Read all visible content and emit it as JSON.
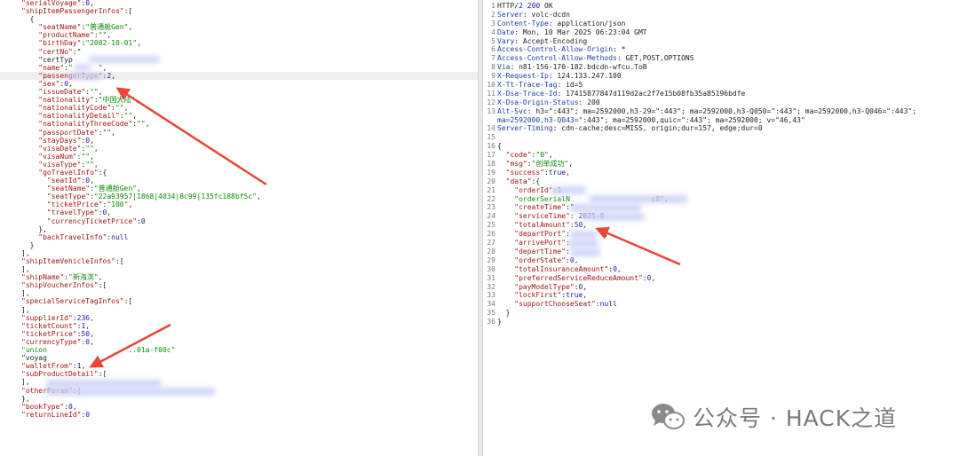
{
  "left_lines": [
    {
      "text": "\"serialVoyage\":0,"
    },
    {
      "text": "\"shipItemPassengerInfos\":["
    },
    {
      "text": "  {"
    },
    {
      "text": "    \"seatName\":\"普通舱Gen\","
    },
    {
      "text": "    \"productName\":\"\","
    },
    {
      "text": "    \"birthDay\":\"2002-10-01\","
    },
    {
      "text": "    \"certNo\":\""
    },
    {
      "text": "    \"certTyp"
    },
    {
      "text": "    \"name\":\"      \","
    },
    {
      "text": "    \"passengerType\":2,",
      "hl": true
    },
    {
      "text": "    \"sex\":0,"
    },
    {
      "text": "    \"issueDate\":\"\","
    },
    {
      "text": "    \"nationality\":\"中国大陆\","
    },
    {
      "text": "    \"nationalityCode\":\"\","
    },
    {
      "text": "    \"nationalityDetail\":\"\","
    },
    {
      "text": "    \"nationalityThreeCode\":\"\","
    },
    {
      "text": "    \"passportDate\":\"\","
    },
    {
      "text": "    \"stayDays\":0,"
    },
    {
      "text": "    \"visaDate\":\"\","
    },
    {
      "text": "    \"visaNum\":\"\","
    },
    {
      "text": "    \"visaType\":\"\","
    },
    {
      "text": "    \"goTravelInfo\":{"
    },
    {
      "text": "      \"seatId\":0,"
    },
    {
      "text": "      \"seatName\":\"普通舱Gen\","
    },
    {
      "text": "      \"seatType\":\"22a93957|1868|4034|8c99|135fc188bf5c\","
    },
    {
      "text": "      \"ticketPrice\":\"100\","
    },
    {
      "text": "      \"travelType\":0,"
    },
    {
      "text": "      \"currencyTicketPrice\":0"
    },
    {
      "text": "    },"
    },
    {
      "text": "    \"backTravelInfo\":null"
    },
    {
      "text": "  }"
    },
    {
      "text": "],"
    },
    {
      "text": "\"shipItemVehicleInfos\":["
    },
    {
      "text": "],"
    },
    {
      "text": "\"shipName\":\"新海滨\","
    },
    {
      "text": "\"shipVoucherInfos\":["
    },
    {
      "text": "],"
    },
    {
      "text": "\"specialServiceTagInfos\":["
    },
    {
      "text": "],"
    },
    {
      "text": "\"supplierId\":236,"
    },
    {
      "text": "\"ticketCount\":1,"
    },
    {
      "text": "\"ticketPrice\":50,"
    },
    {
      "text": "\"currencyType\":0,"
    },
    {
      "text": "\"union                   ..01a-f00c\""
    },
    {
      "text": "\"voyag"
    },
    {
      "text": "\"walletFrom\":1,"
    },
    {
      "text": "\"subProductDetail\":["
    },
    {
      "text": "],"
    },
    {
      "text": "\"otherParam\":{"
    },
    {
      "text": "},"
    },
    {
      "text": "\"bookType\":0,"
    },
    {
      "text": "\"returnLineId\":0"
    }
  ],
  "right_lines": [
    {
      "no": "1",
      "text": "HTTP/2 200 OK"
    },
    {
      "no": "2",
      "text": "Server: volc-dcdn"
    },
    {
      "no": "3",
      "text": "Content-Type: application/json"
    },
    {
      "no": "4",
      "text": "Date: Mon, 10 Mar 2025 06:23:04 GMT"
    },
    {
      "no": "5",
      "text": "Vary: Accept-Encoding"
    },
    {
      "no": "6",
      "text": "Access-Control-Allow-Origin: *"
    },
    {
      "no": "7",
      "text": "Access-Control-Allow-Methods: GET,POST,OPTIONS"
    },
    {
      "no": "8",
      "text": "Via: n81-156-170-182.bdcdn-wfcu.ToB"
    },
    {
      "no": "9",
      "text": "X-Request-Ip: 124.133.247.100"
    },
    {
      "no": "10",
      "text": "X-Tt-Trace-Tag: id=5"
    },
    {
      "no": "11",
      "text": "X-Dsa-Trace-Id: 17415877847d119d2ac2f7e15b08fb35a85196bdfe"
    },
    {
      "no": "12",
      "text": "X-Dsa-Origin-Status: 200"
    },
    {
      "no": "13",
      "text": "Alt-Svc: h3=\":443\"; ma=2592000,h3-29=\":443\"; ma=2592000,h3-Q050=\":443\"; ma=2592000,h3-Q046=\":443\";"
    },
    {
      "no": "",
      "text": "ma=2592000,h3-Q043=\":443\"; ma=2592000,quic=\":443\"; ma=2592000; v=\"46,43\""
    },
    {
      "no": "14",
      "text": "Server-Timing: cdn-cache;desc=MISS, origin;dur=157, edge;dur=0"
    },
    {
      "no": "15",
      "text": ""
    },
    {
      "no": "16",
      "text": "{"
    },
    {
      "no": "17",
      "text": "  \"code\":\"0\","
    },
    {
      "no": "18",
      "text": "  \"msg\":\"创单成功\","
    },
    {
      "no": "19",
      "text": "  \"success\":true,"
    },
    {
      "no": "20",
      "text": "  \"data\":{"
    },
    {
      "no": "21",
      "text": "    \"orderId\":1"
    },
    {
      "no": "22",
      "text": "    \"orderSerialN                   c8\","
    },
    {
      "no": "23",
      "text": "    \"createTime\":\""
    },
    {
      "no": "24",
      "text": "    \"serviceTime\": 2025-0"
    },
    {
      "no": "25",
      "text": "    \"totalAmount\":50,"
    },
    {
      "no": "26",
      "text": "    \"departPort\":        ,"
    },
    {
      "no": "27",
      "text": "    \"arrivePort\":"
    },
    {
      "no": "28",
      "text": "    \"departTime\":"
    },
    {
      "no": "29",
      "text": "    \"orderState\":0,"
    },
    {
      "no": "30",
      "text": "    \"totalInsuranceAmount\":0,"
    },
    {
      "no": "31",
      "text": "    \"preferredServiceReduceAmount\":0,"
    },
    {
      "no": "32",
      "text": "    \"payModelType\":0,"
    },
    {
      "no": "33",
      "text": "    \"lockFirst\":true,"
    },
    {
      "no": "34",
      "text": "    \"supportChooseSeat\":null"
    },
    {
      "no": "35",
      "text": "  }"
    },
    {
      "no": "36",
      "text": "}"
    }
  ],
  "watermark": {
    "text": "公众号 · HACK之道",
    "icon": "wechat-icon"
  },
  "colors": {
    "arrow": "#e8453c",
    "key": "#a31515",
    "string": "#0a8a0a",
    "header_key": "#1f3da6"
  }
}
